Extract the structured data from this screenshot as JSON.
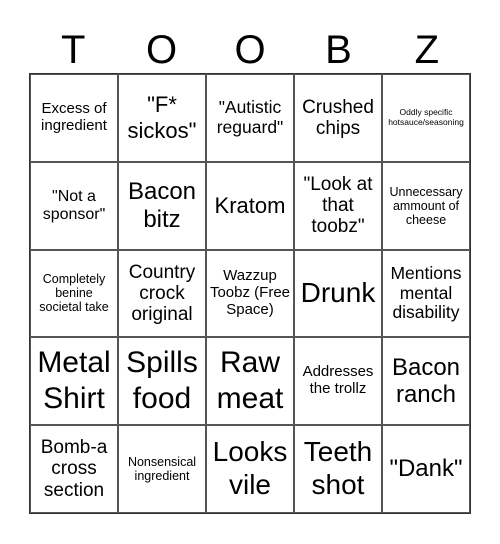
{
  "header": [
    "T",
    "O",
    "O",
    "B",
    "Z"
  ],
  "cells": [
    {
      "text": "Excess of ingredient",
      "size": "s15"
    },
    {
      "text": "\"F* sickos\"",
      "size": "s22"
    },
    {
      "text": "\"Autistic reguard\"",
      "size": "s17"
    },
    {
      "text": "Crushed chips",
      "size": "s19"
    },
    {
      "text": "Oddly specific hotsauce/seasoning",
      "size": "s8"
    },
    {
      "text": "\"Not a sponsor\"",
      "size": "s16"
    },
    {
      "text": "Bacon bitz",
      "size": "s24"
    },
    {
      "text": "Kratom",
      "size": "s22"
    },
    {
      "text": "\"Look at that toobz\"",
      "size": "s19"
    },
    {
      "text": "Unnecessary ammount of cheese",
      "size": "s12"
    },
    {
      "text": "Completely benine societal take",
      "size": "s12"
    },
    {
      "text": "Country crock original",
      "size": "s19"
    },
    {
      "text": "Wazzup Toobz (Free Space)",
      "size": "s15"
    },
    {
      "text": "Drunk",
      "size": "s28"
    },
    {
      "text": "Mentions mental disability",
      "size": "s17"
    },
    {
      "text": "Metal Shirt",
      "size": "s30"
    },
    {
      "text": "Spills food",
      "size": "s30"
    },
    {
      "text": "Raw meat",
      "size": "s30"
    },
    {
      "text": "Addresses the trollz",
      "size": "s15"
    },
    {
      "text": "Bacon ranch",
      "size": "s24"
    },
    {
      "text": "Bomb-a cross section",
      "size": "s19"
    },
    {
      "text": "Nonsensical ingredient",
      "size": "s12"
    },
    {
      "text": "Looks vile",
      "size": "s28"
    },
    {
      "text": "Teeth shot",
      "size": "s28"
    },
    {
      "text": "\"Dank\"",
      "size": "s24"
    }
  ]
}
